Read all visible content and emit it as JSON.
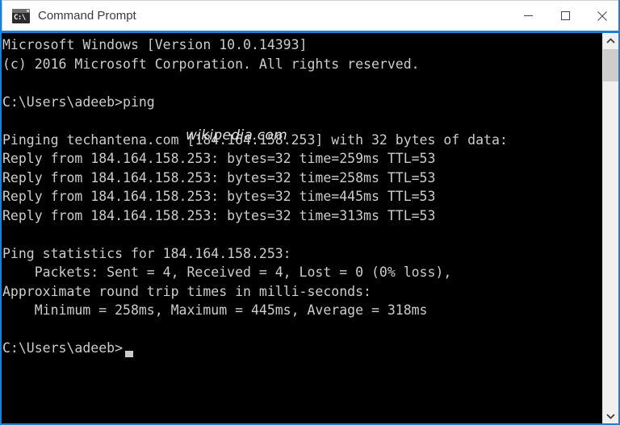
{
  "window": {
    "title": "Command Prompt",
    "icon": "cmd-icon",
    "icon_glyph": "C:\\",
    "border_color": "#1b7fd4",
    "titlebar_bg": "#ffffff",
    "console_bg": "#000000",
    "console_fg": "#cccccc"
  },
  "controls": {
    "minimize_label": "Minimize",
    "maximize_label": "Maximize",
    "close_label": "Close"
  },
  "console": {
    "lines": [
      "Microsoft Windows [Version 10.0.14393]",
      "(c) 2016 Microsoft Corporation. All rights reserved.",
      "",
      "C:\\Users\\adeeb>ping",
      "",
      "Pinging techantena.com [184.164.158.253] with 32 bytes of data:",
      "Reply from 184.164.158.253: bytes=32 time=259ms TTL=53",
      "Reply from 184.164.158.253: bytes=32 time=258ms TTL=53",
      "Reply from 184.164.158.253: bytes=32 time=445ms TTL=53",
      "Reply from 184.164.158.253: bytes=32 time=313ms TTL=53",
      "",
      "Ping statistics for 184.164.158.253:",
      "    Packets: Sent = 4, Received = 4, Lost = 0 (0% loss),",
      "Approximate round trip times in milli-seconds:",
      "    Minimum = 258ms, Maximum = 445ms, Average = 318ms",
      "",
      "C:\\Users\\adeeb>"
    ],
    "text": "Microsoft Windows [Version 10.0.14393]\n(c) 2016 Microsoft Corporation. All rights reserved.\n\nC:\\Users\\adeeb>ping\n\nPinging techantena.com [184.164.158.253] with 32 bytes of data:\nReply from 184.164.158.253: bytes=32 time=259ms TTL=53\nReply from 184.164.158.253: bytes=32 time=258ms TTL=53\nReply from 184.164.158.253: bytes=32 time=445ms TTL=53\nReply from 184.164.158.253: bytes=32 time=313ms TTL=53\n\nPing statistics for 184.164.158.253:\n    Packets: Sent = 4, Received = 4, Lost = 0 (0% loss),\nApproximate round trip times in milli-seconds:\n    Minimum = 258ms, Maximum = 445ms, Average = 318ms\n\nC:\\Users\\adeeb>",
    "prompt": "C:\\Users\\adeeb>",
    "command_typed": "ping",
    "os_version": "10.0.14393",
    "copyright_year": "2016",
    "ping_host": "techantena.com",
    "ping_ip": "184.164.158.253",
    "ping_bytes": "32",
    "reply_times_ms": [
      "259",
      "258",
      "445",
      "313"
    ],
    "ttl": "53",
    "packets_sent": "4",
    "packets_received": "4",
    "packets_lost": "0",
    "loss_percent": "0%",
    "minimum_ms": "258",
    "maximum_ms": "445",
    "average_ms": "318"
  },
  "annotation": {
    "text": "wikipedia.com"
  },
  "scrollbar": {
    "up_arrow": "chevron-up-icon",
    "down_arrow": "chevron-down-icon",
    "thumb_label": "scrollbar-thumb"
  }
}
